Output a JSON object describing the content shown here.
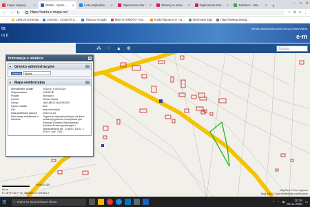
{
  "browser": {
    "tabs": [
      {
        "label": "mapa zagosp...",
        "color": "#e53935",
        "active": false
      },
      {
        "label": "Warta - Syste...",
        "color": "#1565c0",
        "active": true
      },
      {
        "label": "Lista artykułów...",
        "color": "#1e88e5",
        "active": false
      },
      {
        "label": "Ogłoszenia Sier...",
        "color": "#d81b60",
        "active": false
      },
      {
        "label": "Witamy w serw...",
        "color": "#d81b60",
        "active": false
      },
      {
        "label": "Ogłoszenia Sier...",
        "color": "#d81b60",
        "active": false
      },
      {
        "label": "Jakubice - Ma...",
        "color": "#43a047",
        "active": false
      }
    ],
    "new_tab": "+",
    "url": "https://warta.e-mapa.net",
    "back": "←",
    "forward": "→",
    "reload": "↻",
    "bookmarks": [
      {
        "label": "LIBRUS Synergia",
        "color": "#fbc02d"
      },
      {
        "label": "LeoKO2 - Cloud Air G...",
        "color": "#1e88e5"
      },
      {
        "label": "Tłumacz Google",
        "color": "#1e88e5"
      },
      {
        "label": "Moje OTOMOTO • oto...",
        "color": "#e53935"
      },
      {
        "label": "Kredyt hipoteczny - ra...",
        "color": "#fb8c00"
      },
      {
        "label": "thermomix logo",
        "color": "#43a047"
      },
      {
        "label": "https://www.przetarg...",
        "color": "#757575"
      }
    ]
  },
  "site": {
    "brand_top": "ta",
    "brand_bottom": "m Ir",
    "gov_note": "Serwis prowadzony przez Urząd Gminy Warta",
    "logo": "e-m"
  },
  "search": {
    "placeholder": "Szukaj..."
  },
  "panel": {
    "title": "Informacja o obiekcie",
    "admin_section": {
      "title": "Granice administracyjne",
      "label": "Gmina",
      "value": "Warta"
    },
    "map_section": {
      "title": "Mapa ewidencyjna",
      "rows": [
        {
          "k": "Identyfikator działki",
          "v": "101406_5.0016.623"
        },
        {
          "k": "Województwo",
          "v": "ŁÓDZKIE"
        },
        {
          "k": "Powiat",
          "v": "Sieradzki"
        },
        {
          "k": "Gmina",
          "v": "Gmina Warta"
        },
        {
          "k": "Obręb",
          "v": "JAKUBICE-BASZKÓW"
        },
        {
          "k": "Numer działki",
          "v": "623"
        },
        {
          "k": "KW",
          "v": "brak informacji"
        },
        {
          "k": "Data publikacji danych",
          "v": "2019-11-22"
        },
        {
          "k": "Informacje dodatkowe o obiekcie",
          "v": "Organem odpowiedzialnym za dane ewidencji gruntów i budynków jest Starosta Powiatu Sieradzkiego (Ustawa Prawo geodezyjne i kartograficzne art. 7d pkt 1, Dz.U. z 2019 r. poz. 725)."
        }
      ]
    }
  },
  "map_footer": {
    "scale_text": "50 m",
    "plan_label": "PLANO 180",
    "coords_e": "E: 18°37'42.7\"",
    "coords_n": "N: 4309817.9",
    "coords_extra": "474310.0",
    "copyright_1": "MapTiles © Geo-System",
    "copyright_2": "Map data © OpenStreetMap contributors"
  },
  "taskbar": {
    "search_placeholder": "Wpisz tu wyszukiwane słowa",
    "time": "20:38",
    "date": "03.11.2020"
  }
}
